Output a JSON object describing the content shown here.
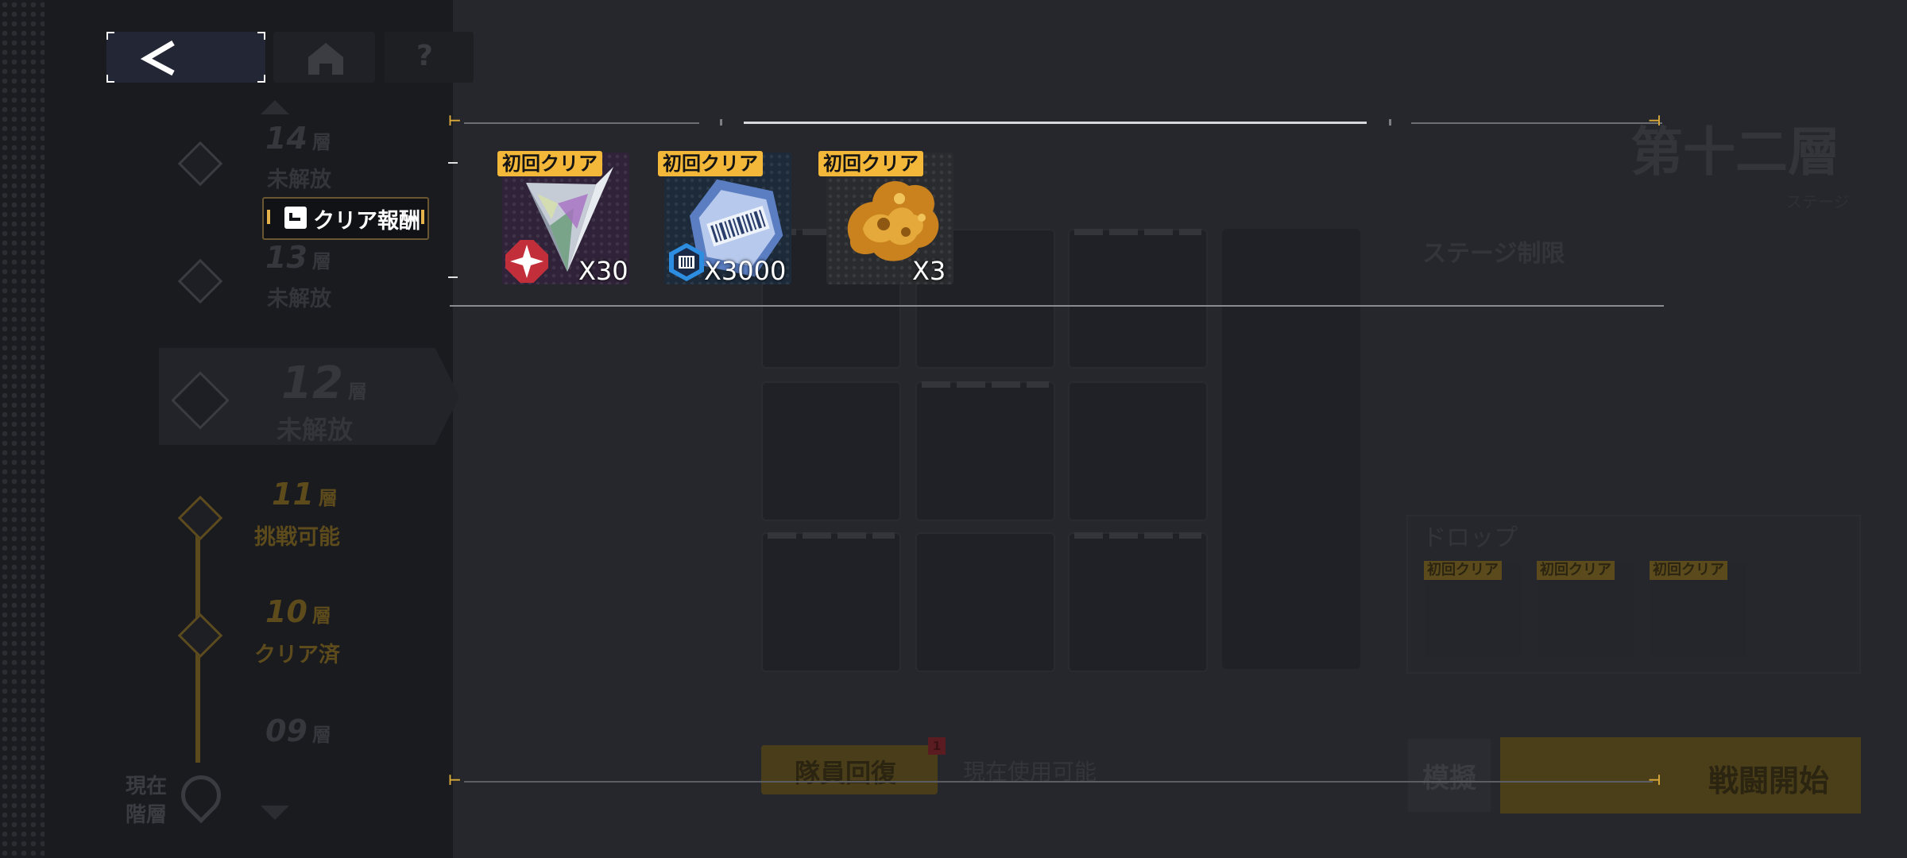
{
  "nav": {
    "back_icon": "chevron-left-icon",
    "home_icon": "home-icon",
    "help_label": "?"
  },
  "floors": [
    {
      "num": "14",
      "suffix": "層",
      "status": "未解放"
    },
    {
      "num": "13",
      "suffix": "層",
      "status": "未解放"
    },
    {
      "num": "12",
      "suffix": "層",
      "status": "未解放"
    },
    {
      "num": "11",
      "suffix": "層",
      "status": "挑戦可能"
    },
    {
      "num": "10",
      "suffix": "層",
      "status": "クリア済"
    },
    {
      "num": "09",
      "suffix": "層",
      "status": ""
    }
  ],
  "current_floor_label": [
    "現在",
    "階層"
  ],
  "stage": {
    "title": "第十二層",
    "subtitle": "ステージ",
    "limit_label": "ステージ制限",
    "drop_label": "ドロップ",
    "drop_tags": [
      "初回クリア",
      "初回クリア",
      "初回クリア"
    ]
  },
  "bottom": {
    "recover_label": "隊員回復",
    "recover_badge": "1",
    "available_text": "現在使用可能",
    "mock_label": "模擬",
    "battle_label": "戦闘開始"
  },
  "popup": {
    "tab_label": "クリア報酬",
    "rewards": [
      {
        "tag": "初回クリア",
        "qty": "X30",
        "icon": "crystal-icon"
      },
      {
        "tag": "初回クリア",
        "qty": "X3000",
        "icon": "data-chip-icon"
      },
      {
        "tag": "初回クリア",
        "qty": "X3",
        "icon": "gold-ore-icon"
      }
    ]
  },
  "colors": {
    "accent_gold": "#f3b83a",
    "background": "#1b1c20",
    "overlay_line": "#d8d8dc"
  }
}
